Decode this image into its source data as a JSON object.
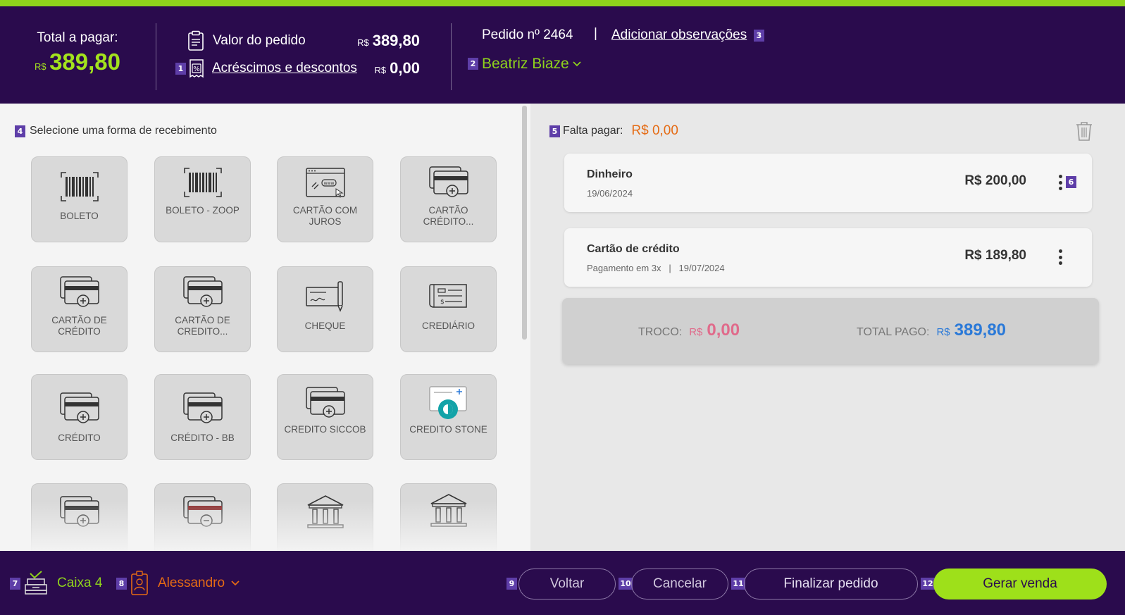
{
  "header": {
    "total_label": "Total a pagar:",
    "total_currency": "R$",
    "total_value": "389,80",
    "order_value_label": "Valor do pedido",
    "order_value_currency": "R$",
    "order_value": "389,80",
    "badge_1": "1",
    "adjust_label": "Acréscimos e descontos",
    "adjust_currency": "R$",
    "adjust_value": "0,00",
    "order_number": "Pedido nº 2464",
    "separator": "|",
    "add_notes": "Adicionar observações",
    "badge_3": "3",
    "badge_2": "2",
    "customer": "Beatriz Biaze"
  },
  "left": {
    "badge_4": "4",
    "section_title": "Selecione uma forma de recebimento",
    "methods": [
      {
        "label": "BOLETO",
        "icon": "barcode-icon"
      },
      {
        "label": "BOLETO - ZOOP",
        "icon": "barcode-icon"
      },
      {
        "label": "CARTÃO COM JUROS",
        "icon": "web-link-icon"
      },
      {
        "label": "CARTÃO CRÉDITO...",
        "icon": "card-plus-icon"
      },
      {
        "label": "CARTÃO DE CRÉDITO",
        "icon": "card-plus-icon"
      },
      {
        "label": "CARTÃO DE CREDITO...",
        "icon": "card-plus-icon"
      },
      {
        "label": "CHEQUE",
        "icon": "cheque-icon"
      },
      {
        "label": "CREDIÁRIO",
        "icon": "crediario-icon"
      },
      {
        "label": "CRÉDITO",
        "icon": "card-plus-icon"
      },
      {
        "label": "CRÉDITO - BB",
        "icon": "card-plus-icon"
      },
      {
        "label": "CREDITO SICCOB",
        "icon": "card-plus-icon"
      },
      {
        "label": "CREDITO STONE",
        "icon": "stone-icon"
      }
    ]
  },
  "right": {
    "badge_5": "5",
    "missing_label": "Falta pagar:",
    "missing_value": "R$ 0,00",
    "payments": [
      {
        "name": "Dinheiro",
        "sub": "19/06/2024",
        "value": "R$ 200,00"
      },
      {
        "name": "Cartão de crédito",
        "sub": "Pagamento em 3x   |   19/07/2024",
        "value": "R$ 189,80"
      }
    ],
    "badge_6": "6",
    "change_label": "TROCO:",
    "change_currency": "R$",
    "change_value": "0,00",
    "paid_label": "TOTAL PAGO:",
    "paid_currency": "R$",
    "paid_value": "389,80"
  },
  "footer": {
    "badge_7": "7",
    "register": "Caixa 4",
    "badge_8": "8",
    "seller": "Alessandro",
    "badge_9": "9",
    "back": "Voltar",
    "badge_10": "10",
    "cancel": "Cancelar",
    "badge_11": "11",
    "finish_order": "Finalizar pedido",
    "badge_12": "12",
    "generate_sale": "Gerar venda"
  },
  "colors": {
    "brand_purple": "#2a0b4d",
    "accent_green": "#9ee01a",
    "orange": "#e56b14",
    "pink": "#e06b8b",
    "blue": "#2a79d8"
  }
}
